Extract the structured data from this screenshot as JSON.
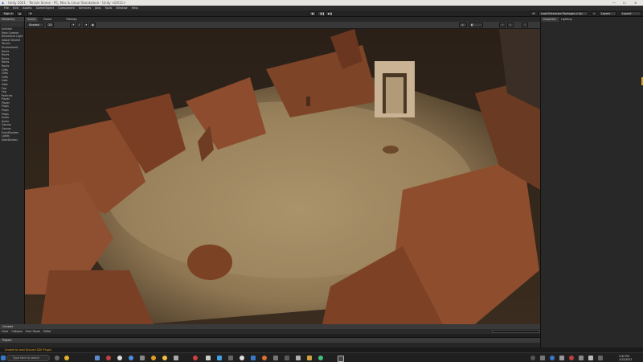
{
  "title_bar": {
    "title": "Unity 2021 - Terrain Scene - PC, Mac & Linux Standalone - Unity <DX11>",
    "minimize_glyph": "—",
    "maximize_glyph": "☐",
    "close_glyph": "✕"
  },
  "menu": [
    "File",
    "Edit",
    "Assets",
    "GameObject",
    "Component",
    "Services",
    "Jobs",
    "Tools",
    "Window",
    "Help"
  ],
  "toolbar": {
    "account_label": "Sign in",
    "layers_label": "Layers",
    "layout_label": "Layout",
    "extension_label": "Load Extension Packages  v  Up"
  },
  "hierarchy": {
    "tab_label": "Hierarchy",
    "items": [
      "Untitled",
      "Main Camera",
      "Directional Light",
      "Global Volume",
      "Terrain",
      "Environment",
      "Rocks",
      "Rocks",
      "Rocks",
      "Rocks",
      "Rocks",
      "Cliffs",
      "Cliffs",
      "Cliffs",
      "Gate",
      "Gate",
      "Fog",
      "Fog",
      "Particles",
      "Player",
      "Player",
      "Props",
      "Props",
      "Props",
      "Audio",
      "Audio",
      "Canvas",
      "Canvas",
      "EventSystem",
      "Lights",
      "DontDestroy"
    ]
  },
  "scene": {
    "tabs": [
      "Scene",
      "Game",
      "Tilemap"
    ],
    "tools": [
      "Shaded",
      "2D"
    ]
  },
  "inspector": {
    "tabs": [
      "Inspector",
      "Lighting"
    ]
  },
  "console": {
    "tab_label": "Console",
    "bar_items": [
      "Clear",
      "Collapse",
      "Error Pause",
      "Editor"
    ]
  },
  "project": {
    "tab_label": "Project"
  },
  "status": {
    "message": "Unable to load Discord SDK Plugin"
  },
  "taskbar": {
    "search_placeholder": "Type here to search",
    "time": "3:42 PM",
    "date": "1/12/2022"
  },
  "colors": {
    "accent": "#e0a020",
    "sand": "#9c8460",
    "rock": "#8a4a2c"
  }
}
